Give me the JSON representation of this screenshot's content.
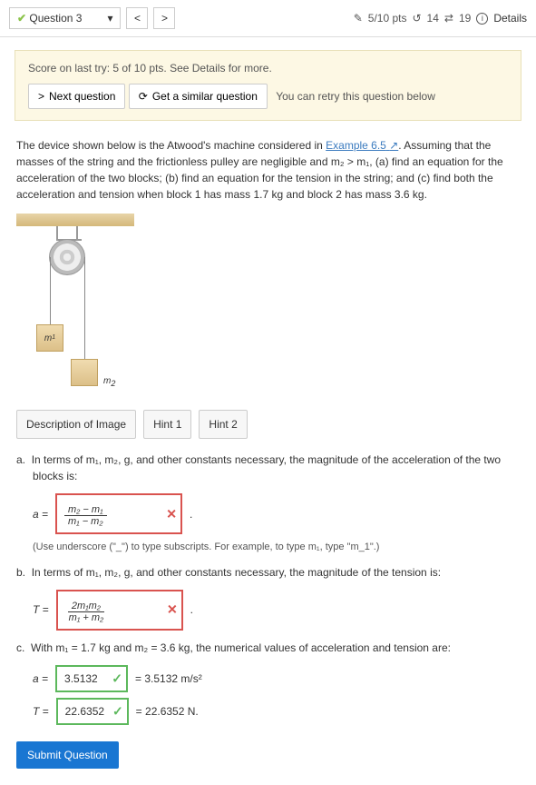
{
  "header": {
    "question_label": "Question 3",
    "points": "5/10 pts",
    "attempts_used": "14",
    "attempts_total": "19",
    "details": "Details"
  },
  "scorebox": {
    "line1": "Score on last try: 5 of 10 pts. See Details for more.",
    "next": "Next question",
    "similar": "Get a similar question",
    "retry": "You can retry this question below"
  },
  "problem": {
    "p1_a": "The device shown below is the Atwood's machine considered in ",
    "link": "Example 6.5",
    "p1_b": ". Assuming that the masses of the string and the frictionless pulley are negligible and m₂ > m₁, (a) find an equation for the acceleration of the two blocks; (b) find an equation for the tension in the string; and (c) find both the acceleration and tension when block 1 has mass 1.7 kg and block 2 has mass 3.6 kg."
  },
  "image": {
    "m1": "m",
    "m1_sub": "1",
    "m2": "m",
    "m2_sub": "2"
  },
  "tabs": {
    "desc": "Description of Image",
    "hint1": "Hint 1",
    "hint2": "Hint 2"
  },
  "parts": {
    "a": {
      "label": "a.",
      "text": "In terms of m₁, m₂, g, and other constants necessary, the magnitude of the acceleration of the two blocks is:",
      "var": "a =",
      "num": "m₂ − m₁",
      "den": "m₁ − m₂",
      "note": "(Use underscore (\"_\") to type subscripts. For example, to type m₁, type \"m_1\".)"
    },
    "b": {
      "label": "b.",
      "text": "In terms of m₁, m₂, g, and other constants necessary, the magnitude of the tension is:",
      "var": "T =",
      "num": "2m₁m₂",
      "den": "m₁ + m₂"
    },
    "c": {
      "label": "c.",
      "text": "With m₁ = 1.7 kg and m₂ = 3.6 kg, the numerical values of acceleration and tension are:",
      "a_var": "a =",
      "a_val": "3.5132",
      "a_res": "= 3.5132  m/s²",
      "t_var": "T =",
      "t_val": "22.6352",
      "t_res": "= 22.6352  N."
    }
  },
  "submit": "Submit Question",
  "icons": {
    "ext": "↗",
    "reload": "⟳",
    "back": "↺",
    "clock": "①"
  }
}
